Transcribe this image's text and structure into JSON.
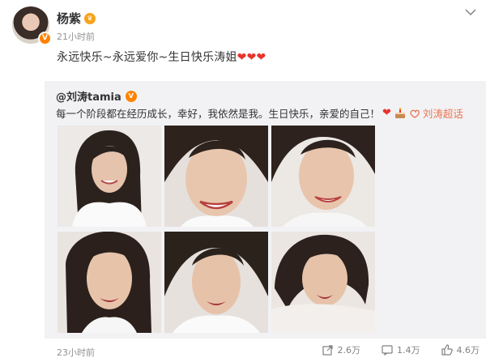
{
  "post": {
    "user_name": "杨紫",
    "time": "21小时前",
    "text": "永远快乐~永远爱你~生日快乐涛姐",
    "hearts": [
      "❤",
      "❤",
      "❤"
    ]
  },
  "repost": {
    "author": "@刘涛tamia",
    "text": "每一个阶段都在经历成长，幸好，我依然是我。生日快乐，亲爱的自己！",
    "heart": "❤",
    "topic_link": "刘涛超话",
    "photos_count": 6
  },
  "footer": {
    "time": "23小时前",
    "share_count": "2.6万",
    "comment_count": "1.4万",
    "like_count": "4.6万"
  },
  "icons": {
    "more": "chevron-down-icon",
    "share": "share-icon",
    "comment": "comment-icon",
    "like": "thumbs-up-icon",
    "verified": "verified-badge-icon",
    "cake": "cake-icon",
    "super_topic": "super-topic-icon"
  },
  "colors": {
    "verified_orange": "#ff8200",
    "link": "#eb7350",
    "heart": "#e8332b",
    "repost_bg": "#f2f2f5"
  }
}
